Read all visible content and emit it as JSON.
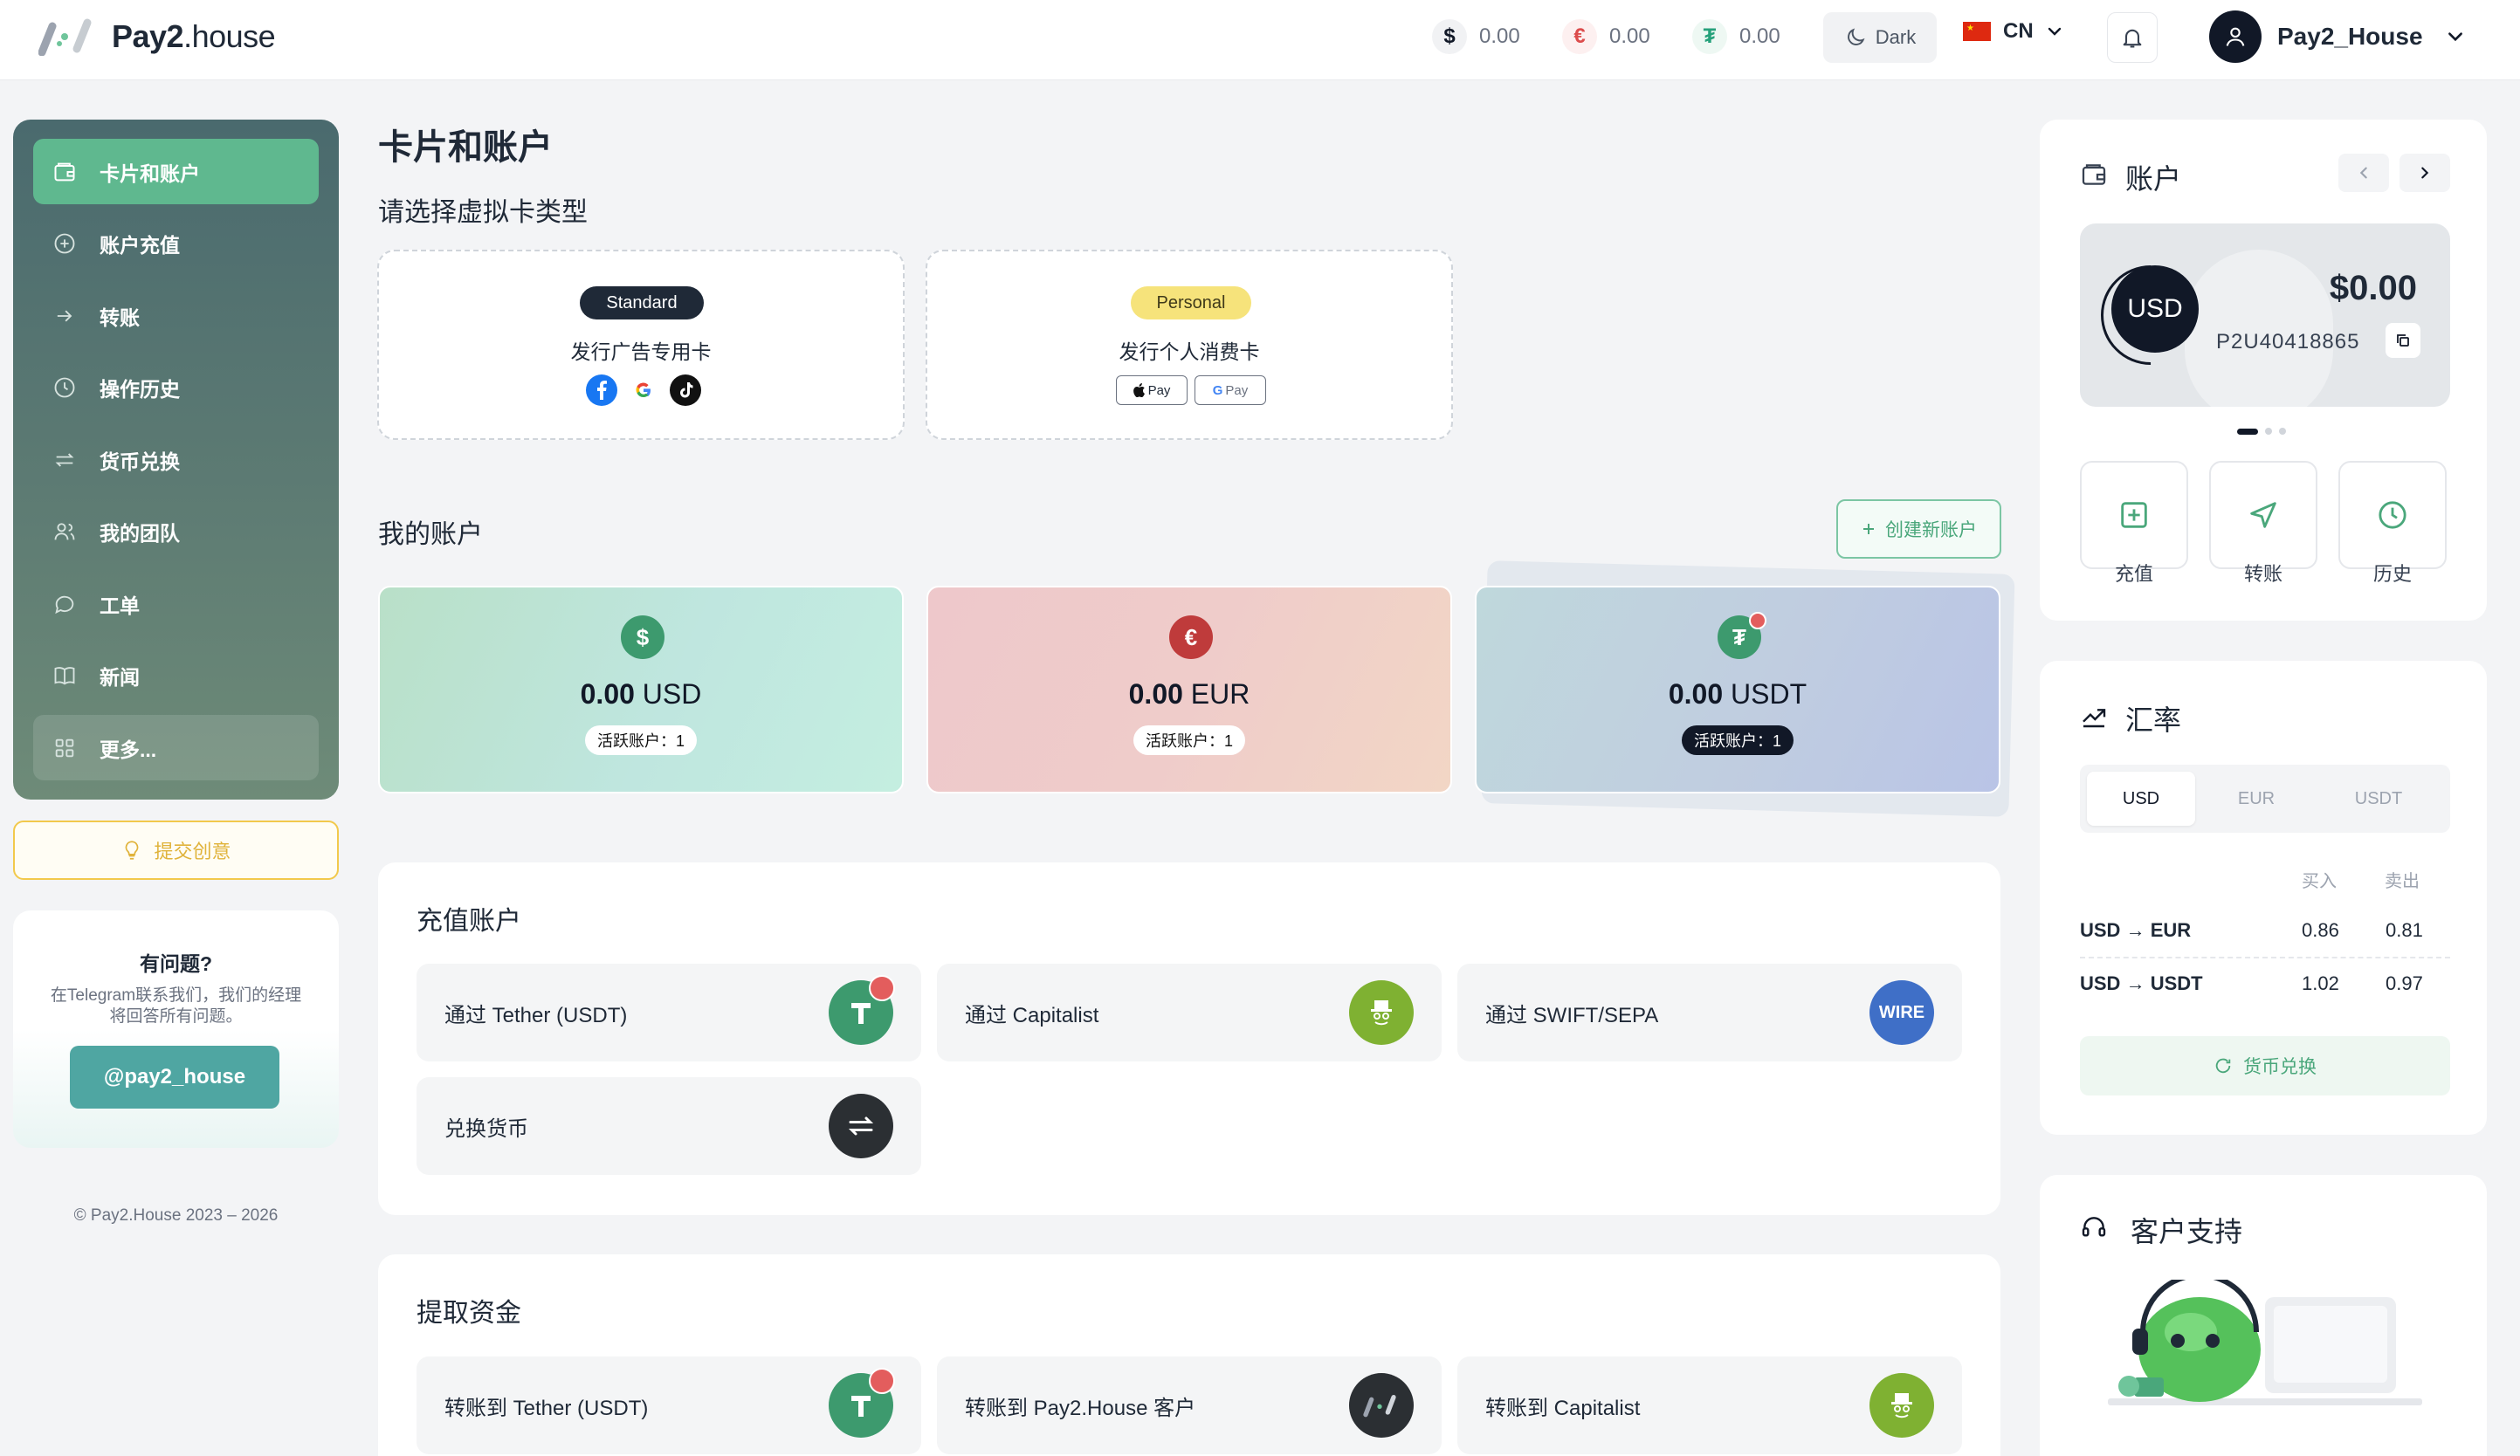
{
  "header": {
    "logo_word_bold": "Pay2",
    "logo_word_rest": ".house",
    "balances": [
      {
        "symbol": "$",
        "amount": "0.00",
        "color": "#111827",
        "bg": "#f1f2f4"
      },
      {
        "symbol": "€",
        "amount": "0.00",
        "color": "#dc4c4c",
        "bg": "#fdf0f0"
      },
      {
        "symbol": "₮",
        "amount": "0.00",
        "color": "#26a17b",
        "bg": "#eef8f3"
      }
    ],
    "theme_label": "Dark",
    "language": "CN",
    "username": "Pay2_House"
  },
  "sidebar": {
    "items": [
      {
        "label": "卡片和账户",
        "icon": "wallet-icon"
      },
      {
        "label": "账户充值",
        "icon": "plus-circle-icon"
      },
      {
        "label": "转账",
        "icon": "arrow-right-icon"
      },
      {
        "label": "操作历史",
        "icon": "clock-icon"
      },
      {
        "label": "货币兑换",
        "icon": "exchange-icon"
      },
      {
        "label": "我的团队",
        "icon": "users-icon"
      },
      {
        "label": "工单",
        "icon": "chat-icon"
      },
      {
        "label": "新闻",
        "icon": "book-icon"
      },
      {
        "label": "更多...",
        "icon": "grid-icon"
      }
    ],
    "idea_button": "提交创意",
    "help": {
      "title": "有问题?",
      "text_line1": "在Telegram联系我们，我们的经理",
      "text_line2": "将回答所有问题。",
      "button": "@pay2_house"
    },
    "copyright": "© Pay2.House 2023 – 2026"
  },
  "main": {
    "title": "卡片和账户",
    "card_section_title": "请选择虚拟卡类型",
    "cards": [
      {
        "badge": "Standard",
        "title": "发行广告专用卡"
      },
      {
        "badge": "Personal",
        "title": "发行个人消费卡",
        "pay1": "Pay",
        "pay2": "Pay"
      }
    ],
    "accounts_title": "我的账户",
    "create_button": "创建新账户",
    "accounts": [
      {
        "symbol": "$",
        "amount": "0.00",
        "currency": "USD",
        "badge": "活跃账户：1"
      },
      {
        "symbol": "€",
        "amount": "0.00",
        "currency": "EUR",
        "badge": "活跃账户：1"
      },
      {
        "symbol": "₮",
        "amount": "0.00",
        "currency": "USDT",
        "badge": "活跃账户：1"
      }
    ],
    "topup_title": "充值账户",
    "topup_options": [
      "通过 Tether (USDT)",
      "通过 Capitalist",
      "通过 SWIFT/SEPA",
      "兑换货币"
    ],
    "wire_label": "WIRE",
    "withdraw_title": "提取资金",
    "withdraw_options": [
      "转账到 Tether (USDT)",
      "转账到 Pay2.House 客户",
      "转账到 Capitalist"
    ]
  },
  "right": {
    "account_title": "账户",
    "currency_badge": "USD",
    "balance": "$0.00",
    "account_id": "P2U40418865",
    "actions": [
      "充值",
      "转账",
      "历史"
    ],
    "rates_title": "汇率",
    "rate_tabs": [
      "USD",
      "EUR",
      "USDT"
    ],
    "rate_headers": {
      "buy": "买入",
      "sell": "卖出"
    },
    "rates": [
      {
        "from": "USD",
        "to": "EUR",
        "buy": "0.86",
        "sell": "0.81"
      },
      {
        "from": "USD",
        "to": "USDT",
        "buy": "1.02",
        "sell": "0.97"
      }
    ],
    "exchange_button": "货币兑换",
    "support_title": "客户支持"
  }
}
